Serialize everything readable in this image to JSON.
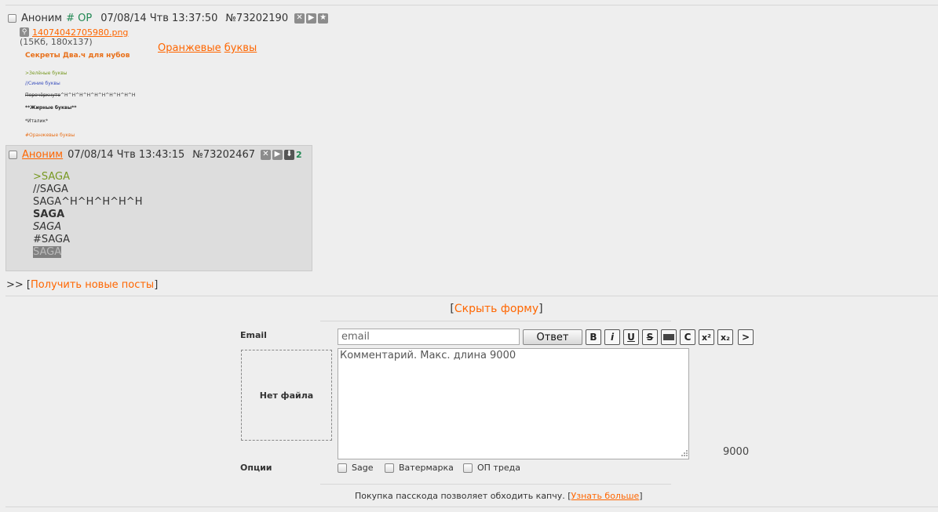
{
  "op": {
    "name": "Аноним",
    "trip": "# OP",
    "date": "07/08/14 Чтв 13:37:50",
    "num": "№73202190",
    "file_name": "14074042705980.png",
    "file_info": "(15Кб, 180x137)",
    "thumb": {
      "title": "Секреты Два.ч для нубов",
      "green": ">Зелёные буквы",
      "blue": "//Синие буквы",
      "strike": "Перечёркнуто",
      "strike_tail": "^H^H^H^H^H^H^H^H^H^H",
      "bold": "**Жирные буквы**",
      "italic": "*Италик*",
      "orange": "#Оранжевые буквы"
    },
    "text_word1": "Оранжевые",
    "text_word2": "буквы"
  },
  "reply": {
    "name": "Аноним",
    "date": "07/08/14 Чтв 13:43:15",
    "num": "№73202467",
    "count": "2",
    "lines": {
      "green": ">SAGA",
      "blue": "//SAGA",
      "strike": "SAGA^H^H^H^H^H",
      "bold": "SAGA",
      "italic": "SAGA",
      "hash": "#SAGA",
      "spoiler": "SAGA"
    }
  },
  "get_new": {
    "prefix": ">> [",
    "link": "Получить новые посты",
    "suffix": "]"
  },
  "hide_form": {
    "open": "[",
    "link": "Скрыть форму",
    "close": "]"
  },
  "form": {
    "email_label": "Email",
    "email_placeholder": "email",
    "submit_label": "Ответ",
    "markup_buttons": {
      "bold": "B",
      "italic": "i",
      "underline": "U",
      "strike": "S",
      "spoiler": "",
      "code": "C",
      "sup": "x²",
      "sub": "x₂",
      "quote": ">"
    },
    "file_drop": "Нет файла",
    "comment_placeholder": "Комментарий. Макс. длина 9000",
    "counter": "9000",
    "options_label": "Опции",
    "options": {
      "sage": "Sage",
      "watermark": "Ватермарка",
      "op": "ОП треда"
    },
    "passcode_text": "Покупка пасскода позволяет обходить капчу. [",
    "passcode_link": "Узнать больше",
    "passcode_close": "]"
  },
  "colors": {
    "link": "#ff6600",
    "trip": "#228854",
    "greentext": "#789922",
    "blue": "#3a4fbd",
    "reply_bg": "#dddddd",
    "page_bg": "#eeeeee"
  }
}
